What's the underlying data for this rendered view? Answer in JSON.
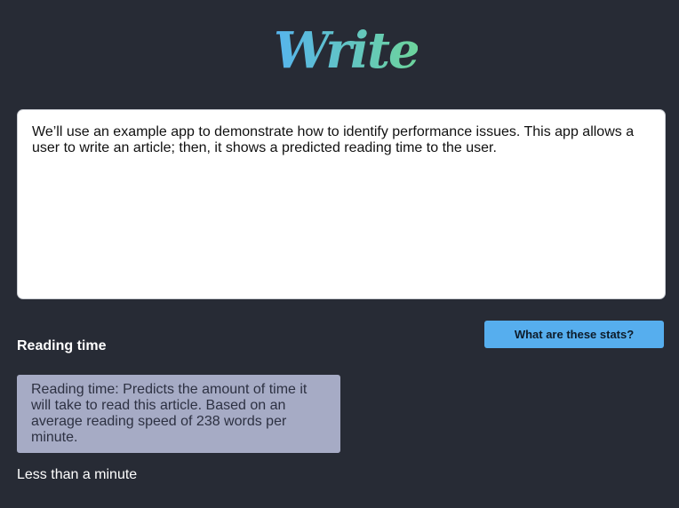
{
  "app": {
    "logo_text": "Write",
    "colors": {
      "background": "#272b35",
      "accent": "#56aeee",
      "logo_gradient_start": "#56b4ef",
      "logo_gradient_end": "#6dd49b",
      "tooltip_bg": "#a6abc5"
    }
  },
  "editor": {
    "value": "We’ll use an example app to demonstrate how to identify performance issues. This app allows a user to write an article; then, it shows a predicted reading time to the user."
  },
  "stats_button": {
    "label": "What are these stats?"
  },
  "reading": {
    "heading": "Reading time",
    "tooltip": "Reading time: Predicts the amount of time it will take to read this article. Based on an average reading speed of 238 words per minute.",
    "value": "Less than a minute"
  }
}
